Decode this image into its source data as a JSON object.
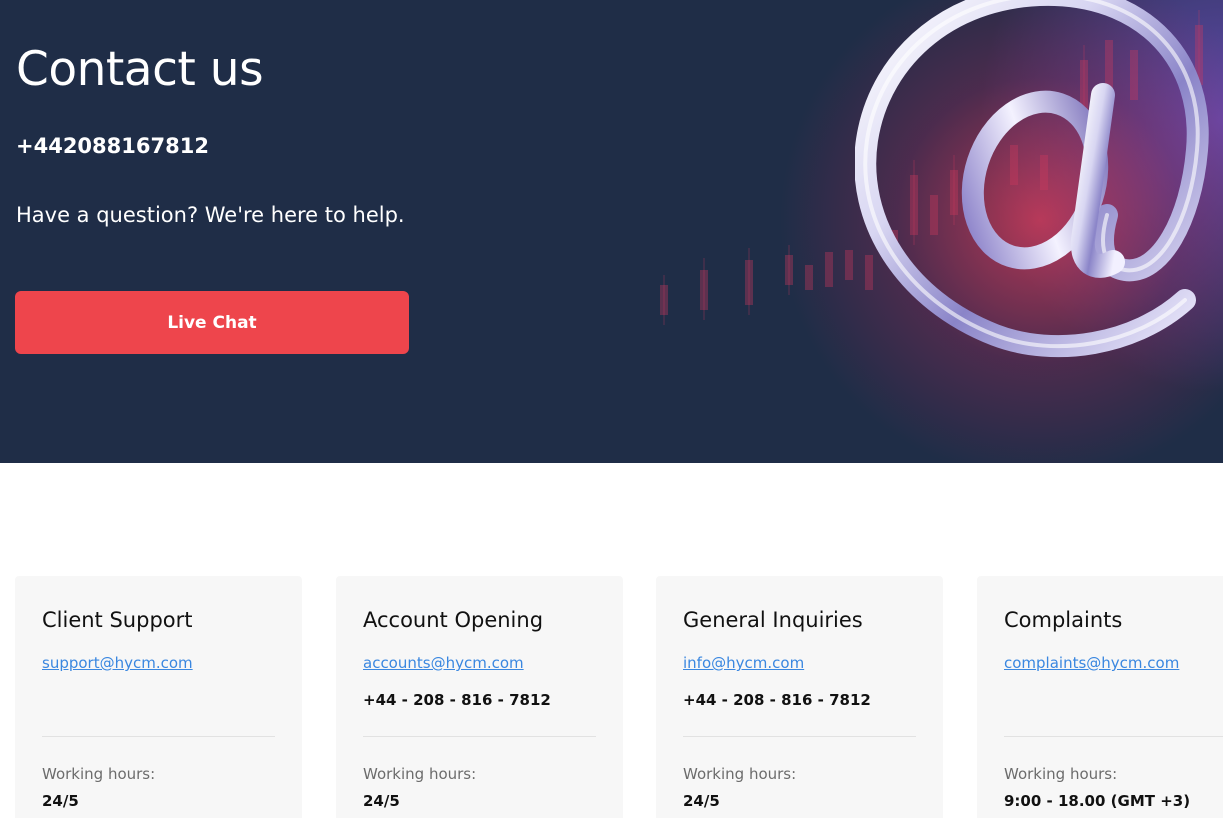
{
  "hero": {
    "title": "Contact us",
    "phone": "+442088167812",
    "subtitle": "Have a question? We're here to help.",
    "cta_label": "Live Chat",
    "image_icon": "at-sign-icon"
  },
  "cards": [
    {
      "title": "Client Support",
      "email": "support@hycm.com",
      "phone": "",
      "hours_label": "Working hours:",
      "hours_value": "24/5"
    },
    {
      "title": "Account Opening",
      "email": "accounts@hycm.com",
      "phone": "+44 - 208 - 816 - 7812",
      "hours_label": "Working hours:",
      "hours_value": "24/5"
    },
    {
      "title": "General Inquiries",
      "email": "info@hycm.com",
      "phone": "+44 - 208 - 816 - 7812",
      "hours_label": "Working hours:",
      "hours_value": "24/5"
    },
    {
      "title": "Complaints",
      "email": "complaints@hycm.com",
      "phone": "",
      "hours_label": "Working hours:",
      "hours_value": "9:00 - 18.00 (GMT +3)"
    }
  ],
  "colors": {
    "hero_background": "#1f2d47",
    "cta_background": "#ee454c",
    "link": "#3a87e0",
    "card_background": "#f7f7f7"
  }
}
